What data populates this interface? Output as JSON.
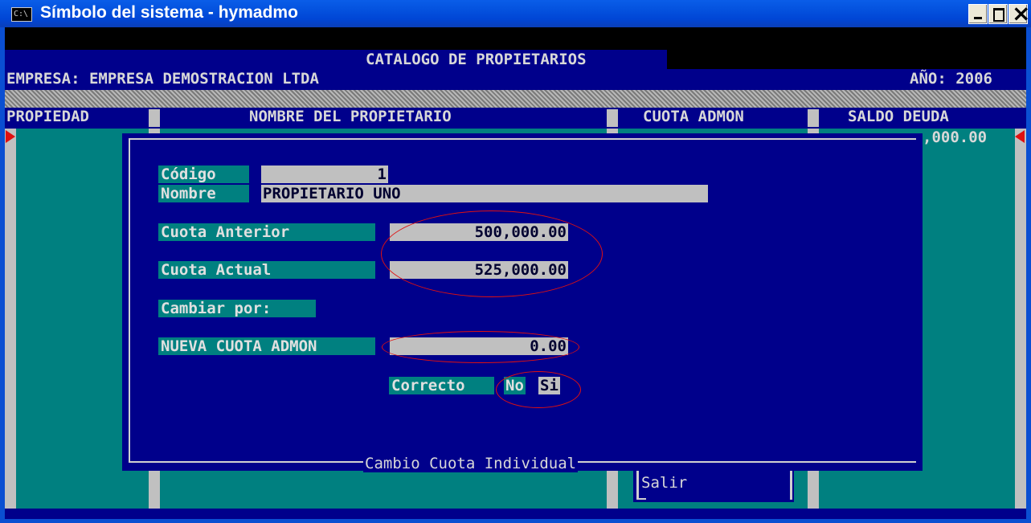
{
  "window": {
    "title": "Símbolo del sistema - hymadmo",
    "icon": "console-icon"
  },
  "header": {
    "title": "CATALOGO DE PROPIETARIOS",
    "empresa": "EMPRESA: EMPRESA DEMOSTRACION LTDA",
    "anio": "AÑO: 2006"
  },
  "columns": {
    "propiedad": "PROPIEDAD",
    "nombre": "NOMBRE DEL PROPIETARIO",
    "cuota": "CUOTA ADMON",
    "saldo": "SALDO DEUDA"
  },
  "row_fragment": ",000.00",
  "dialog": {
    "caption": "Cambio Cuota Individual",
    "codigo_label": "Código",
    "codigo_value": "1",
    "nombre_label": "Nombre",
    "nombre_value": "PROPIETARIO UNO",
    "cuota_anterior_label": "Cuota Anterior",
    "cuota_anterior_value": "500,000.00",
    "cuota_actual_label": "Cuota Actual",
    "cuota_actual_value": "525,000.00",
    "cambiar_label": "Cambiar por:",
    "nueva_label": "NUEVA CUOTA ADMON",
    "nueva_value": "0.00",
    "correcto_label": "Correcto",
    "no_option": "No",
    "si_option": "Si"
  },
  "menu": {
    "salir": "Salir"
  }
}
